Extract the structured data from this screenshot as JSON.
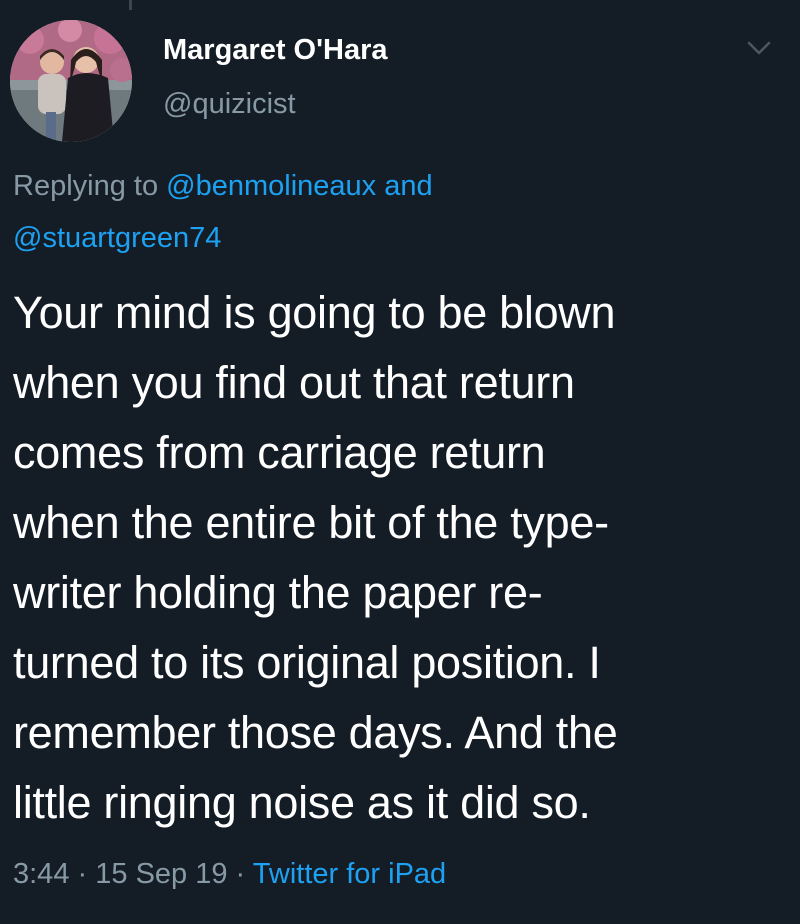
{
  "author": {
    "display_name": "Margaret O'Hara",
    "handle": "@quizicist"
  },
  "reply": {
    "prefix": "Replying to",
    "mention_1": "@benmolineaux",
    "connector": "and",
    "mention_2": "@stuartgreen74"
  },
  "tweet": {
    "text": "Your mind is going to be blown\nwhen you find out that return\ncomes from carriage return\nwhen the entire bit of the type-\nwriter holding the paper re-\nturned to its original position. I\nremember those days. And the\nlittle ringing noise as it did so."
  },
  "meta": {
    "time": "3:44",
    "separator": "·",
    "date": "15 Sep 19",
    "source": "Twitter for iPad"
  },
  "icons": {
    "menu": "chevron-down-icon"
  },
  "colors": {
    "background": "#141d26",
    "secondary_text": "#8899a6",
    "link": "#1da1f2"
  }
}
